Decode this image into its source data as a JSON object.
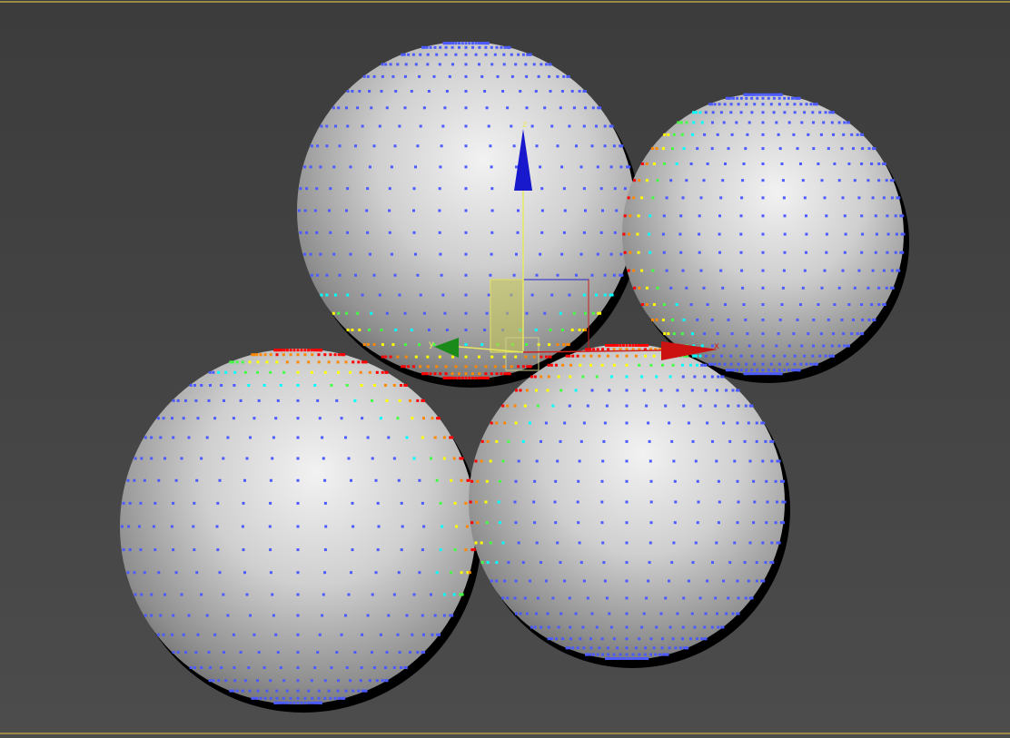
{
  "viewport": {
    "background_color": "#444444",
    "frame_color": "#9a8a48",
    "selected_object": "sphere-top-left"
  },
  "spheres": [
    {
      "id": "sphere-top-left",
      "selected": true,
      "vertex_display": "soft-selection-gradient"
    },
    {
      "id": "sphere-top-right",
      "selected": false,
      "vertex_display": "soft-selection-gradient"
    },
    {
      "id": "sphere-bottom-left",
      "selected": false,
      "vertex_display": "soft-selection-gradient"
    },
    {
      "id": "sphere-bottom-right",
      "selected": false,
      "vertex_display": "soft-selection-gradient"
    }
  ],
  "gizmo": {
    "type": "move",
    "x_axis": {
      "label": "x",
      "color": "#cc1111"
    },
    "y_axis": {
      "label": "y",
      "color": "#1a8a1a"
    },
    "z_axis": {
      "label": "z",
      "color": "#1818cc"
    },
    "active_plane_color": "#c8c850"
  },
  "soft_selection_colors": [
    "#ff0000",
    "#ff8800",
    "#ffff00",
    "#44ff44",
    "#00ffff",
    "#4c5bff"
  ]
}
